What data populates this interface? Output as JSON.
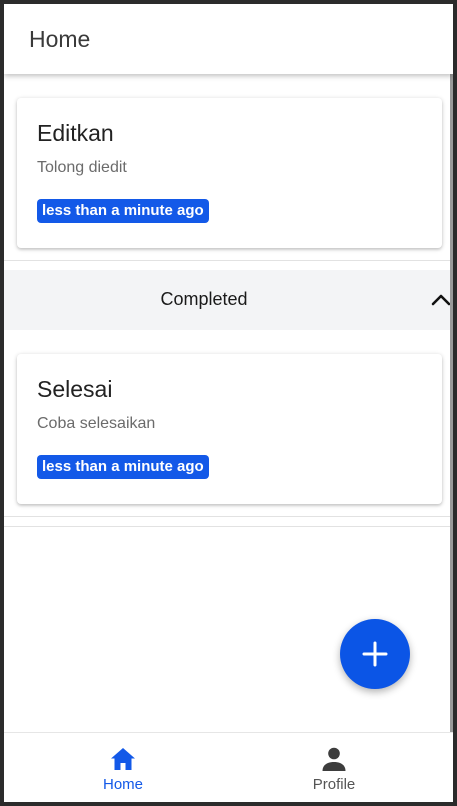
{
  "app": {
    "title": "Home"
  },
  "tasks": [
    {
      "title": "Editkan",
      "description": "Tolong diedit",
      "time": "less than a minute ago"
    }
  ],
  "completed_section": {
    "label": "Completed",
    "expanded": true,
    "icon": "chevron-up-icon"
  },
  "completed_tasks": [
    {
      "title": "Selesai",
      "description": "Coba selesaikan",
      "time": "less than a minute ago"
    }
  ],
  "fab": {
    "icon": "plus-icon"
  },
  "bottom_nav": {
    "items": [
      {
        "label": "Home",
        "icon": "home-icon",
        "active": true
      },
      {
        "label": "Profile",
        "icon": "person-icon",
        "active": false
      }
    ]
  },
  "colors": {
    "accent": "#1359e8",
    "fab": "#0b55e6",
    "section_bg": "#f3f4f6"
  }
}
